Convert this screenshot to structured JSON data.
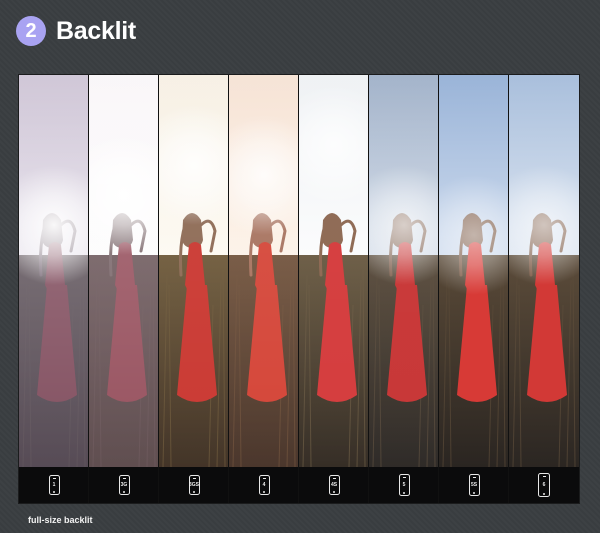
{
  "header": {
    "step_number": "2",
    "title": "Backlit",
    "badge_color": "#a9a3f2"
  },
  "gallery": {
    "devices": [
      {
        "label": "1",
        "tone": "haze-purple"
      },
      {
        "label": "3G",
        "tone": "haze-white"
      },
      {
        "label": "3GS",
        "tone": "warm-white"
      },
      {
        "label": "4",
        "tone": "warm-red"
      },
      {
        "label": "4S",
        "tone": "natural-bright"
      },
      {
        "label": "5",
        "tone": "cool-blue"
      },
      {
        "label": "5S",
        "tone": "clear-blue"
      },
      {
        "label": "6",
        "tone": "soft-blue"
      }
    ]
  },
  "footer": {
    "caption": "full-size backlit"
  },
  "colors": {
    "background": "#3a3e41",
    "dress_red": "#c8322b",
    "text": "#ffffff"
  }
}
